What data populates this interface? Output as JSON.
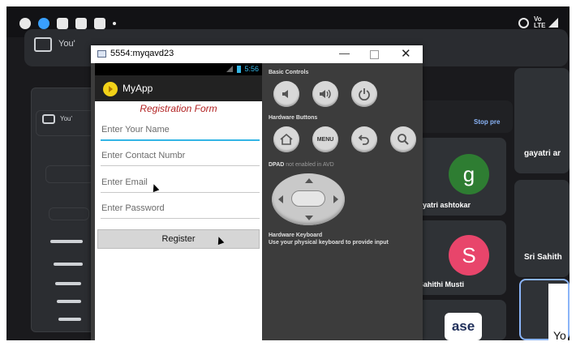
{
  "background_app": {
    "top_tab_label": "You'",
    "mini_tab_label": "You'",
    "stop_label": "Stop pre",
    "participants": [
      {
        "name": "gayatri ar",
        "avatar": ""
      },
      {
        "name": "ayatri ashtokar",
        "avatar": "g"
      },
      {
        "name": "Sri Sahith",
        "avatar": ""
      },
      {
        "name": "Sahithi Musti",
        "avatar": "S"
      },
      {
        "name": "Yo",
        "avatar": ""
      }
    ],
    "logo_text": "ase"
  },
  "colors": {
    "avatar_g": "#2e7d32",
    "avatar_s": "#e8456b",
    "form_title": "#b22222",
    "accent": "#33b5e5"
  },
  "emulator": {
    "title": "5554:myqavd23",
    "window_controls": {
      "minimize": "—",
      "close": "✕"
    },
    "status_time": "5:56",
    "app_name": "MyApp",
    "form": {
      "title": "Registration Form",
      "fields": [
        {
          "placeholder": "Enter Your Name"
        },
        {
          "placeholder": "Enter Contact Numbr"
        },
        {
          "placeholder": "Enter Email"
        },
        {
          "placeholder": "Enter Password"
        }
      ],
      "register_label": "Register"
    },
    "controls": {
      "basic_controls_label": "Basic Controls",
      "hardware_buttons_label": "Hardware Buttons",
      "menu_label": "MENU",
      "dpad_label": "DPAD",
      "dpad_note": "not enabled in AVD",
      "keyboard_title": "Hardware Keyboard",
      "keyboard_note": "Use your physical keyboard to provide input"
    }
  }
}
